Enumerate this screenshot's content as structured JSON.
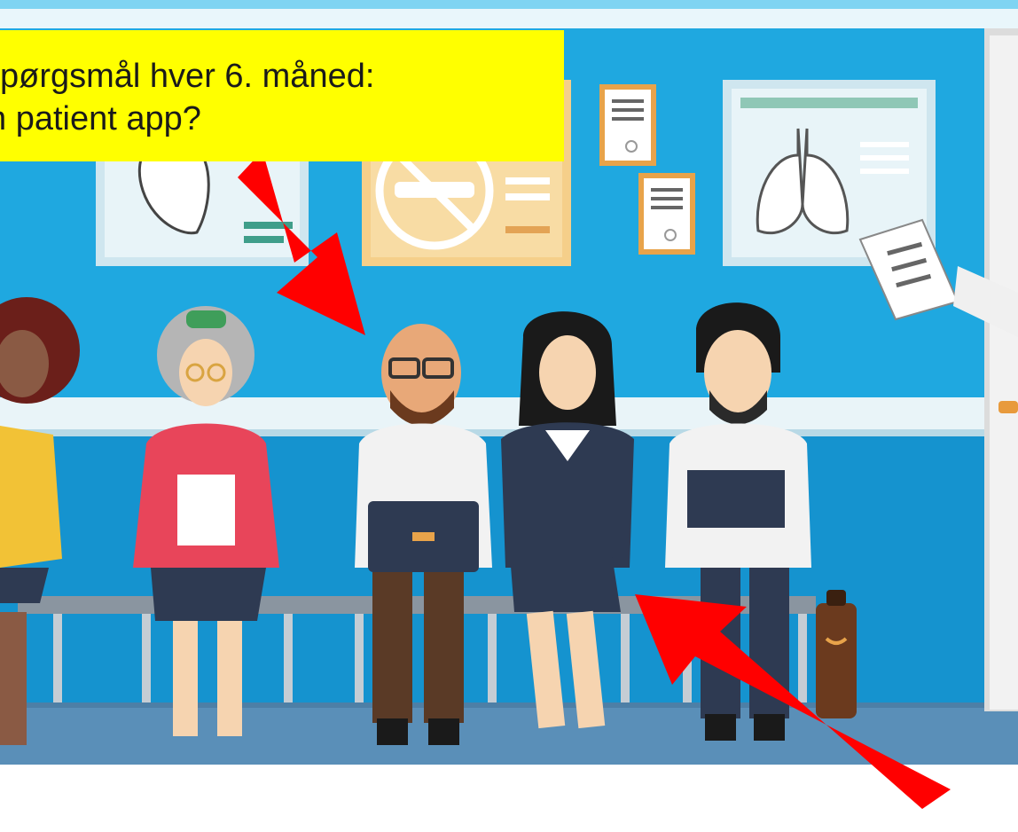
{
  "callout": {
    "line1": "pørgsmål hver 6. måned:",
    "line2": "n patient app?",
    "background": "#ffff00"
  },
  "scene": {
    "wall_color": "#1fa8e0",
    "wall_light": "#7fd4f2",
    "floor_color": "#5a8fb8",
    "arrow_color": "#ff0000",
    "people_count": 5
  },
  "icons": {
    "arrow_top": "red-arrow-pointing-down-left",
    "arrow_bottom": "red-arrow-pointing-up-left"
  }
}
